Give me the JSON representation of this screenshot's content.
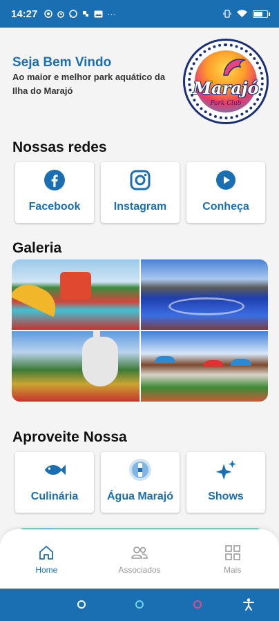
{
  "status_bar": {
    "time": "14:27",
    "battery_level": 0.7,
    "notification_icons": [
      "signal-app-icon",
      "alarm-icon",
      "whatsapp-icon",
      "app-icon",
      "image-icon"
    ],
    "more": "···"
  },
  "header": {
    "welcome": "Seja Bem Vindo",
    "subtitle": "Ao maior e melhor park aquático da Ilha do Marajó",
    "logo_text": "Marajó",
    "logo_subtext": "Park Club"
  },
  "social": {
    "title": "Nossas redes",
    "items": [
      {
        "label": "Facebook",
        "icon": "facebook-icon"
      },
      {
        "label": "Instagram",
        "icon": "instagram-icon"
      },
      {
        "label": "Conheça",
        "icon": "play-icon"
      }
    ]
  },
  "gallery": {
    "title": "Galeria"
  },
  "enjoy": {
    "title": "Aproveite Nossa",
    "items": [
      {
        "label": "Culinária",
        "icon": "fish-icon"
      },
      {
        "label": "Água Marajó",
        "icon": "water-bottle-icon"
      },
      {
        "label": "Shows",
        "icon": "sparkles-icon"
      }
    ]
  },
  "bottom_nav": {
    "items": [
      {
        "label": "Home",
        "icon": "home-icon",
        "active": true
      },
      {
        "label": "Associados",
        "icon": "people-icon",
        "active": false
      },
      {
        "label": "Mais",
        "icon": "grid-icon",
        "active": false
      }
    ]
  },
  "colors": {
    "primary": "#1a6fb3",
    "status_bar": "#1a6fb3",
    "background": "#f4f4f4"
  }
}
